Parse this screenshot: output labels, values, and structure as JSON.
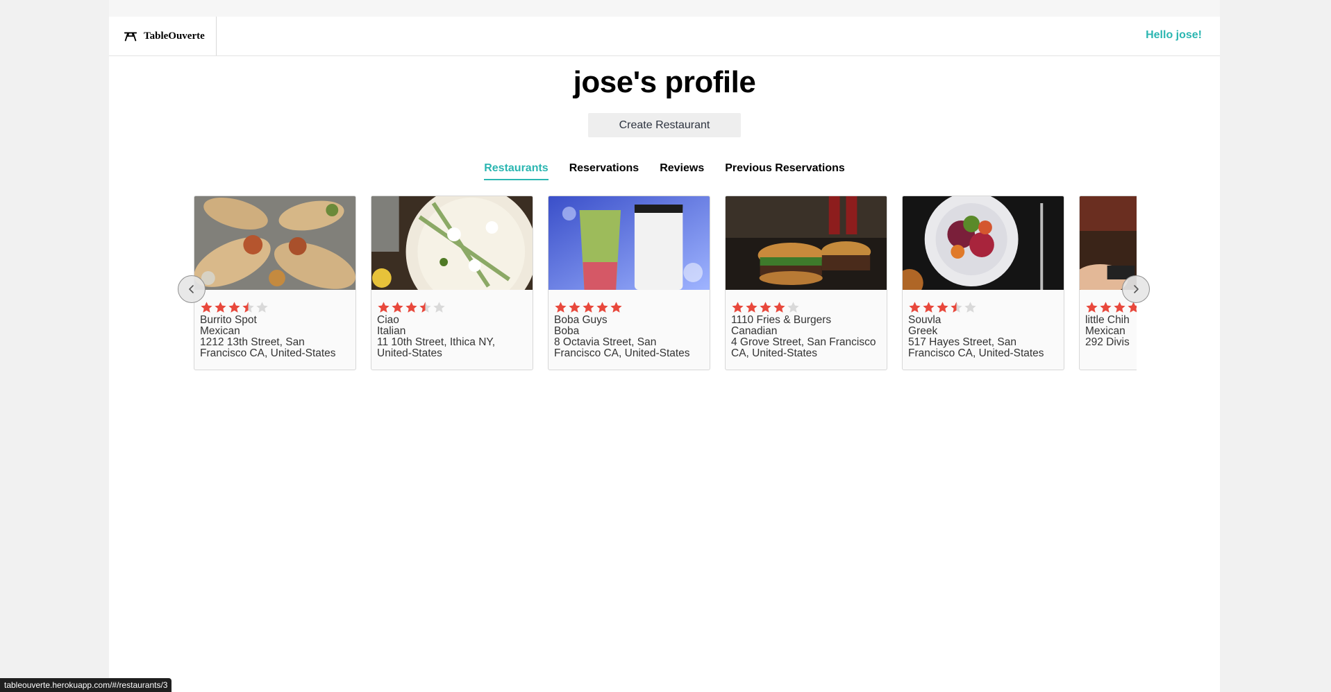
{
  "nav": {
    "brand": "TableOuverte",
    "greeting": "Hello jose!"
  },
  "profile": {
    "title": "jose's profile",
    "create_label": "Create Restaurant"
  },
  "tabs": [
    {
      "label": "Restaurants",
      "active": true
    },
    {
      "label": "Reservations",
      "active": false
    },
    {
      "label": "Reviews",
      "active": false
    },
    {
      "label": "Previous Reservations",
      "active": false
    }
  ],
  "restaurants": [
    {
      "name": "Burrito Spot",
      "cuisine": "Mexican",
      "address": "1212 13th Street, San Francisco CA, United-States",
      "rating": 3.5
    },
    {
      "name": "Ciao",
      "cuisine": "Italian",
      "address": "11 10th Street, Ithica NY, United-States",
      "rating": 3.5
    },
    {
      "name": "Boba Guys",
      "cuisine": "Boba",
      "address": "8 Octavia Street, San Francisco CA, United-States",
      "rating": 5
    },
    {
      "name": "1110 Fries & Burgers",
      "cuisine": "Canadian",
      "address": "4 Grove Street, San Francisco CA, United-States",
      "rating": 4
    },
    {
      "name": "Souvla",
      "cuisine": "Greek",
      "address": "517 Hayes Street, San Francisco CA, United-States",
      "rating": 3.5
    },
    {
      "name": "little Chih",
      "cuisine": "Mexican",
      "address": "292 Divis",
      "rating": 4
    }
  ],
  "colors": {
    "accent": "#2bb6b1",
    "star_filled": "#e8483c",
    "star_empty": "#d9d9d9"
  },
  "icons": {
    "logo": "picnic-table-icon",
    "prev": "chevron-left-icon",
    "next": "chevron-right-icon",
    "star": "star-icon"
  },
  "status_url": "tableouverte.herokuapp.com/#/restaurants/3"
}
